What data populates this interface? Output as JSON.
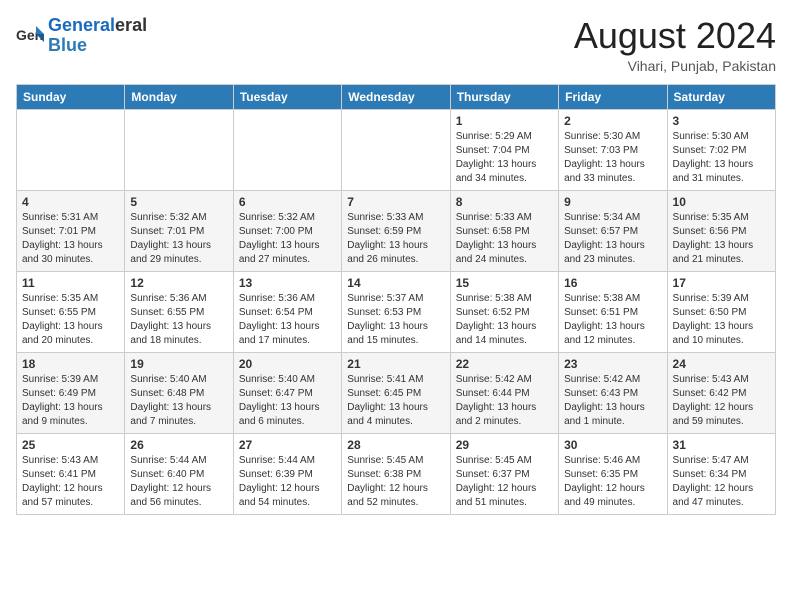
{
  "logo": {
    "line1": "General",
    "line2": "Blue"
  },
  "title": "August 2024",
  "subtitle": "Vihari, Punjab, Pakistan",
  "days_of_week": [
    "Sunday",
    "Monday",
    "Tuesday",
    "Wednesday",
    "Thursday",
    "Friday",
    "Saturday"
  ],
  "weeks": [
    [
      {
        "day": "",
        "info": ""
      },
      {
        "day": "",
        "info": ""
      },
      {
        "day": "",
        "info": ""
      },
      {
        "day": "",
        "info": ""
      },
      {
        "day": "1",
        "info": "Sunrise: 5:29 AM\nSunset: 7:04 PM\nDaylight: 13 hours\nand 34 minutes."
      },
      {
        "day": "2",
        "info": "Sunrise: 5:30 AM\nSunset: 7:03 PM\nDaylight: 13 hours\nand 33 minutes."
      },
      {
        "day": "3",
        "info": "Sunrise: 5:30 AM\nSunset: 7:02 PM\nDaylight: 13 hours\nand 31 minutes."
      }
    ],
    [
      {
        "day": "4",
        "info": "Sunrise: 5:31 AM\nSunset: 7:01 PM\nDaylight: 13 hours\nand 30 minutes."
      },
      {
        "day": "5",
        "info": "Sunrise: 5:32 AM\nSunset: 7:01 PM\nDaylight: 13 hours\nand 29 minutes."
      },
      {
        "day": "6",
        "info": "Sunrise: 5:32 AM\nSunset: 7:00 PM\nDaylight: 13 hours\nand 27 minutes."
      },
      {
        "day": "7",
        "info": "Sunrise: 5:33 AM\nSunset: 6:59 PM\nDaylight: 13 hours\nand 26 minutes."
      },
      {
        "day": "8",
        "info": "Sunrise: 5:33 AM\nSunset: 6:58 PM\nDaylight: 13 hours\nand 24 minutes."
      },
      {
        "day": "9",
        "info": "Sunrise: 5:34 AM\nSunset: 6:57 PM\nDaylight: 13 hours\nand 23 minutes."
      },
      {
        "day": "10",
        "info": "Sunrise: 5:35 AM\nSunset: 6:56 PM\nDaylight: 13 hours\nand 21 minutes."
      }
    ],
    [
      {
        "day": "11",
        "info": "Sunrise: 5:35 AM\nSunset: 6:55 PM\nDaylight: 13 hours\nand 20 minutes."
      },
      {
        "day": "12",
        "info": "Sunrise: 5:36 AM\nSunset: 6:55 PM\nDaylight: 13 hours\nand 18 minutes."
      },
      {
        "day": "13",
        "info": "Sunrise: 5:36 AM\nSunset: 6:54 PM\nDaylight: 13 hours\nand 17 minutes."
      },
      {
        "day": "14",
        "info": "Sunrise: 5:37 AM\nSunset: 6:53 PM\nDaylight: 13 hours\nand 15 minutes."
      },
      {
        "day": "15",
        "info": "Sunrise: 5:38 AM\nSunset: 6:52 PM\nDaylight: 13 hours\nand 14 minutes."
      },
      {
        "day": "16",
        "info": "Sunrise: 5:38 AM\nSunset: 6:51 PM\nDaylight: 13 hours\nand 12 minutes."
      },
      {
        "day": "17",
        "info": "Sunrise: 5:39 AM\nSunset: 6:50 PM\nDaylight: 13 hours\nand 10 minutes."
      }
    ],
    [
      {
        "day": "18",
        "info": "Sunrise: 5:39 AM\nSunset: 6:49 PM\nDaylight: 13 hours\nand 9 minutes."
      },
      {
        "day": "19",
        "info": "Sunrise: 5:40 AM\nSunset: 6:48 PM\nDaylight: 13 hours\nand 7 minutes."
      },
      {
        "day": "20",
        "info": "Sunrise: 5:40 AM\nSunset: 6:47 PM\nDaylight: 13 hours\nand 6 minutes."
      },
      {
        "day": "21",
        "info": "Sunrise: 5:41 AM\nSunset: 6:45 PM\nDaylight: 13 hours\nand 4 minutes."
      },
      {
        "day": "22",
        "info": "Sunrise: 5:42 AM\nSunset: 6:44 PM\nDaylight: 13 hours\nand 2 minutes."
      },
      {
        "day": "23",
        "info": "Sunrise: 5:42 AM\nSunset: 6:43 PM\nDaylight: 13 hours\nand 1 minute."
      },
      {
        "day": "24",
        "info": "Sunrise: 5:43 AM\nSunset: 6:42 PM\nDaylight: 12 hours\nand 59 minutes."
      }
    ],
    [
      {
        "day": "25",
        "info": "Sunrise: 5:43 AM\nSunset: 6:41 PM\nDaylight: 12 hours\nand 57 minutes."
      },
      {
        "day": "26",
        "info": "Sunrise: 5:44 AM\nSunset: 6:40 PM\nDaylight: 12 hours\nand 56 minutes."
      },
      {
        "day": "27",
        "info": "Sunrise: 5:44 AM\nSunset: 6:39 PM\nDaylight: 12 hours\nand 54 minutes."
      },
      {
        "day": "28",
        "info": "Sunrise: 5:45 AM\nSunset: 6:38 PM\nDaylight: 12 hours\nand 52 minutes."
      },
      {
        "day": "29",
        "info": "Sunrise: 5:45 AM\nSunset: 6:37 PM\nDaylight: 12 hours\nand 51 minutes."
      },
      {
        "day": "30",
        "info": "Sunrise: 5:46 AM\nSunset: 6:35 PM\nDaylight: 12 hours\nand 49 minutes."
      },
      {
        "day": "31",
        "info": "Sunrise: 5:47 AM\nSunset: 6:34 PM\nDaylight: 12 hours\nand 47 minutes."
      }
    ]
  ]
}
